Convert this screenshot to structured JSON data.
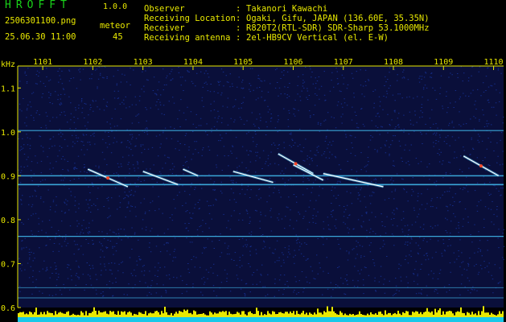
{
  "app": {
    "name": "HROFFT",
    "version": "1.0.0"
  },
  "file_name": "2506301100.png",
  "date_time": "25.06.30 11:00",
  "meteor": {
    "label": "meteor",
    "count": "45"
  },
  "info": [
    {
      "label": "Observer",
      "sep": ":",
      "value": "Takanori Kawachi"
    },
    {
      "label": "Receiving Location",
      "sep": ":",
      "value": "Ogaki, Gifu, JAPAN (136.60E, 35.35N)"
    },
    {
      "label": "Receiver",
      "sep": ":",
      "value": "R820T2(RTL-SDR) SDR-Sharp 53.1000MHz"
    },
    {
      "label": "Receiving antenna",
      "sep": ":",
      "value": "2el-HB9CV Vertical (el. E-W)"
    }
  ],
  "spectrogram": {
    "y_unit": "kHz",
    "y_ticks": [
      "1.1",
      "1.0",
      "0.9",
      "0.8",
      "0.7",
      "0.6"
    ],
    "y_range": [
      0.6,
      1.15
    ],
    "x_ticks": [
      "1101",
      "1102",
      "1103",
      "1104",
      "1105",
      "1106",
      "1107",
      "1108",
      "1109",
      "1110"
    ],
    "x_range": [
      1100.5,
      1110.2
    ],
    "colors": {
      "background": "#0a0f3a",
      "noise": "#1a3aa8",
      "carrier": "#3fb6e8",
      "echo": "#ffffff",
      "hot": "#ff4a2a",
      "activity": "#e8e800",
      "floor": "#18c8e8"
    },
    "carriers": [
      0.9,
      0.88,
      1.003,
      0.762,
      0.645,
      0.622
    ],
    "echoes": [
      {
        "x1": 1101.9,
        "y1": 0.915,
        "x2": 1102.7,
        "y2": 0.875
      },
      {
        "x1": 1103.0,
        "y1": 0.91,
        "x2": 1103.7,
        "y2": 0.88
      },
      {
        "x1": 1103.8,
        "y1": 0.915,
        "x2": 1104.1,
        "y2": 0.9
      },
      {
        "x1": 1104.8,
        "y1": 0.91,
        "x2": 1105.6,
        "y2": 0.885
      },
      {
        "x1": 1105.7,
        "y1": 0.95,
        "x2": 1106.4,
        "y2": 0.905
      },
      {
        "x1": 1106.0,
        "y1": 0.925,
        "x2": 1106.6,
        "y2": 0.89
      },
      {
        "x1": 1106.6,
        "y1": 0.905,
        "x2": 1107.8,
        "y2": 0.875
      },
      {
        "x1": 1109.4,
        "y1": 0.945,
        "x2": 1110.1,
        "y2": 0.9
      }
    ]
  }
}
